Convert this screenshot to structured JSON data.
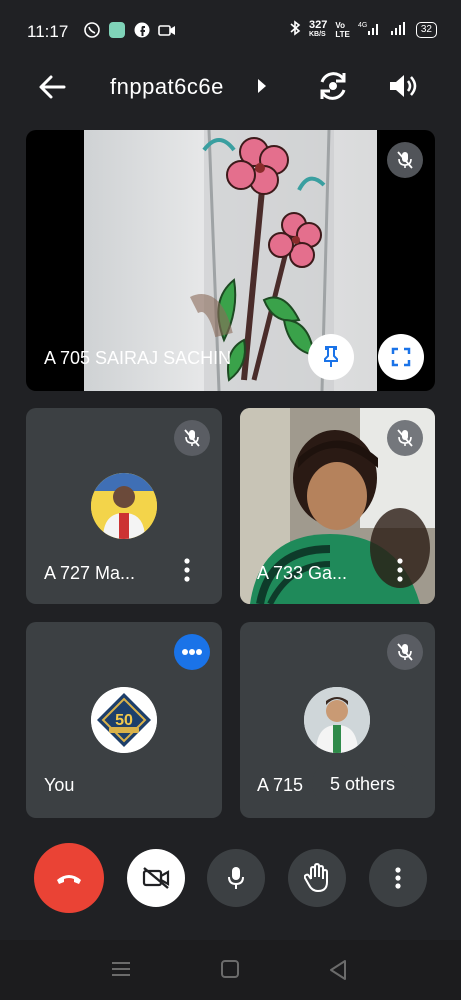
{
  "status_bar": {
    "time": "11:17",
    "speed": "327",
    "speed_unit": "KB/S",
    "battery": "32"
  },
  "header": {
    "meeting_code": "fnppat6c6e"
  },
  "participants": {
    "main": {
      "name": "A 705 SAIRAJ SACHIN"
    },
    "tile_727": {
      "name": "A 727 Ma..."
    },
    "tile_733": {
      "name": "A 733 Ga..."
    },
    "tile_you": {
      "name": "You"
    },
    "tile_715": {
      "name": "A 715"
    },
    "others_label": "5 others",
    "avatar_50_text": "50"
  },
  "colors": {
    "background": "#202124",
    "tile": "#3c4043",
    "end_call": "#ea4335",
    "speaking_badge": "#1a73e8"
  }
}
